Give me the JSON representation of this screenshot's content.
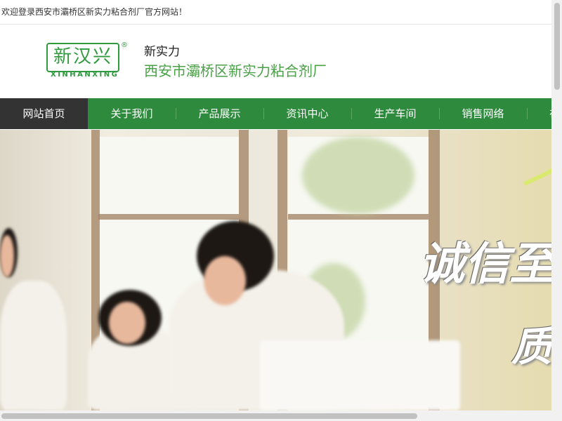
{
  "topbar": {
    "welcome": "欢迎登录西安市灞桥区新实力粘合剂厂官方网站！"
  },
  "header": {
    "logo_text": "新汉兴",
    "logo_reg": "®",
    "logo_pinyin": "XINHANXING",
    "brand_name": "新实力",
    "company_name": "西安市灞桥区新实力粘合剂厂"
  },
  "nav": {
    "items": [
      {
        "label": "网站首页"
      },
      {
        "label": "关于我们"
      },
      {
        "label": "产品展示"
      },
      {
        "label": "资讯中心"
      },
      {
        "label": "生产车间"
      },
      {
        "label": "销售网络"
      },
      {
        "label": "在"
      }
    ],
    "active_index": 0
  },
  "banner": {
    "slogan_line1": "诚信至",
    "slogan_line2": "质"
  },
  "colors": {
    "nav_bg": "#2e8a3c",
    "nav_active": "#333333",
    "brand_green": "#4aa046"
  }
}
